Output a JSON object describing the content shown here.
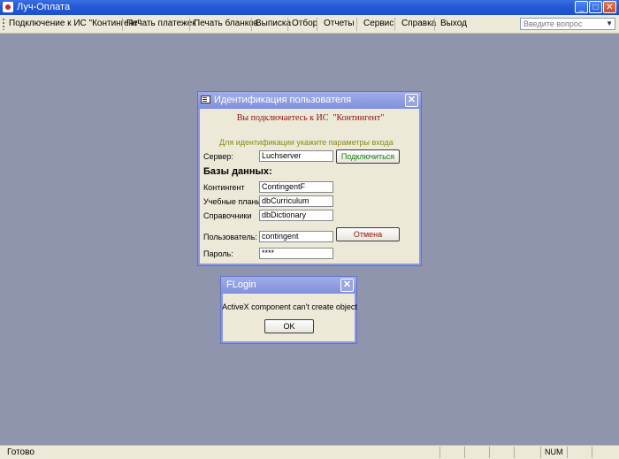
{
  "window": {
    "title": "Луч-Оплата"
  },
  "menu": {
    "items": [
      "Подключение к ИС \"Контингент\"",
      "Печать платежек",
      "Печать бланков",
      "Выписка",
      "Отбор",
      "Отчеты",
      "Сервис",
      "Справка",
      "Выход"
    ],
    "help_placeholder": "Введите вопрос"
  },
  "login_dialog": {
    "title": "Идентификация пользователя",
    "banner": "Вы подключаетесь к ИС  \"Контингент\"",
    "hint": "Для идентификации укажите параметры входа",
    "server_label": "Сервер:",
    "server_value": "Luchserver",
    "connect_button": "Подключиться",
    "db_heading": "Базы данных:",
    "contingent_label": "Контингент",
    "contingent_value": "ContingentF",
    "curricula_label": "Учебные планы",
    "curricula_value": "dbCurriculum",
    "dictionary_label": "Справочники",
    "dictionary_value": "dbDictionary",
    "user_label": "Пользователь:",
    "user_value": "contingent",
    "cancel_button": "Отмена",
    "password_label": "Пароль:",
    "password_value": "****"
  },
  "error_dialog": {
    "title": "FLogin",
    "message": "ActiveX component can't create object",
    "ok_button": "OK"
  },
  "statusbar": {
    "status": "Готово",
    "num_indicator": "NUM"
  },
  "colors": {
    "desktop": "#8e95ad",
    "titlebar": "#255bd8",
    "dialog_title": "#8a98de",
    "banner_text": "#8c1010",
    "connect_text": "#1a7a1a",
    "cancel_text": "#8c1010"
  }
}
